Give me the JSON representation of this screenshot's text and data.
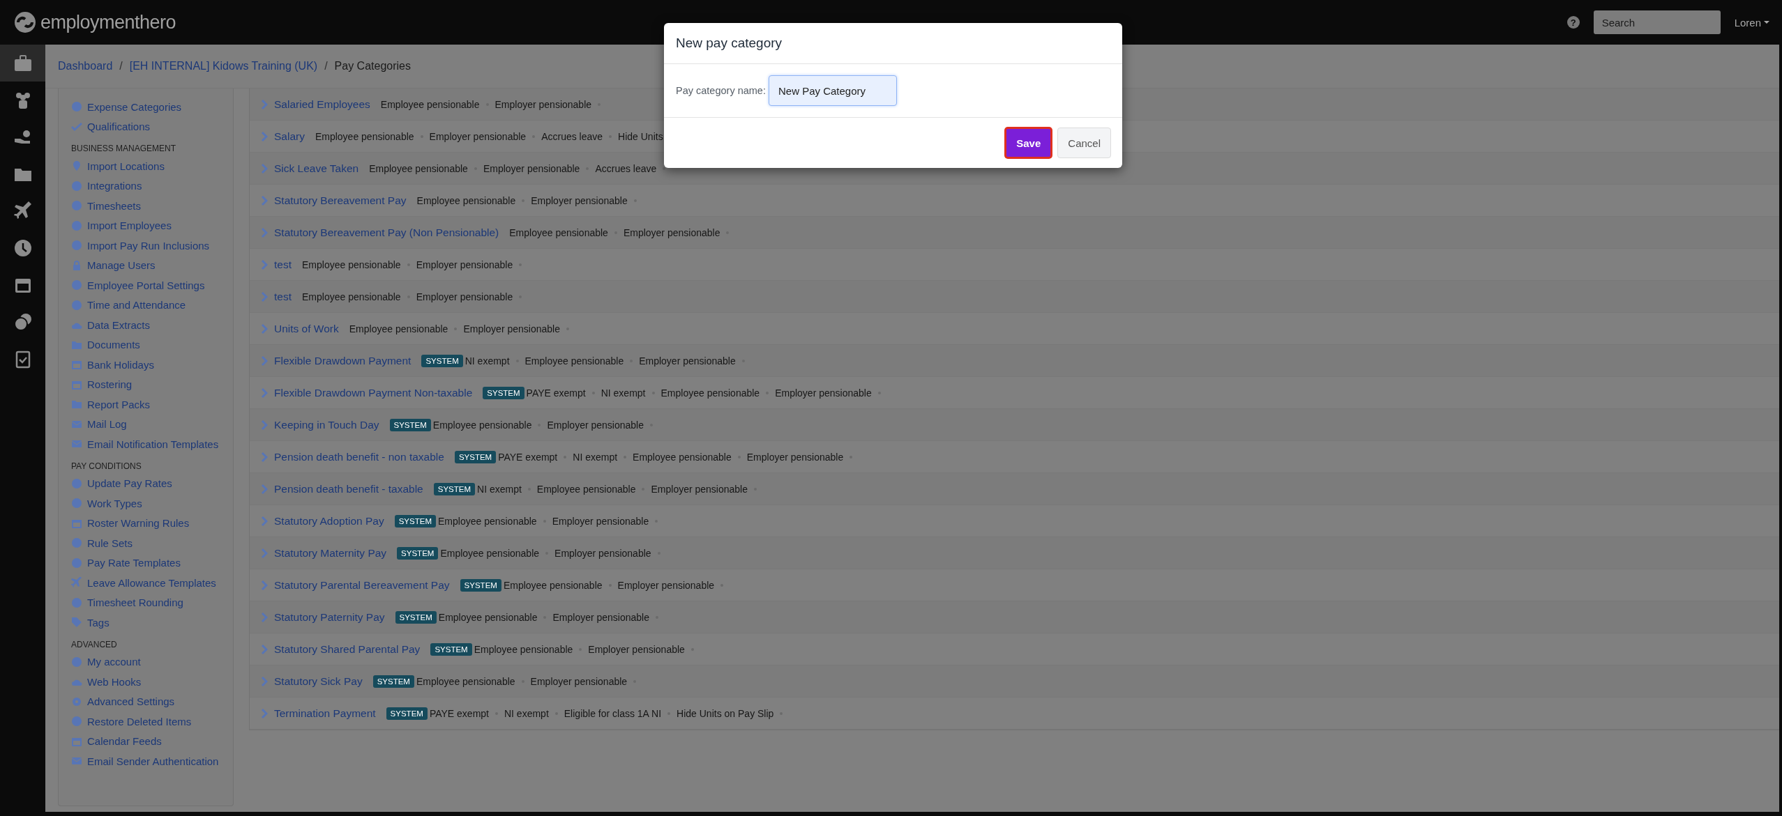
{
  "topbar": {
    "logo": "employmenthero",
    "help": "?",
    "search": {
      "placeholder": "Search"
    },
    "user": "Loren"
  },
  "rail": [
    {
      "selected": true
    },
    {
      "selected": false
    },
    {
      "selected": false
    },
    {
      "selected": false
    },
    {
      "selected": false
    },
    {
      "selected": false
    },
    {
      "selected": false
    },
    {
      "selected": false
    },
    {
      "selected": false
    }
  ],
  "breadcrumb": [
    {
      "label": "Dashboard",
      "link": true
    },
    {
      "separator": "/",
      "label": "[EH INTERNAL] Kidows Training (UK)",
      "link": true
    },
    {
      "separator": "/",
      "label": "Pay Categories",
      "link": false
    }
  ],
  "sidebar": [
    {
      "items": [
        "Expense Categories",
        "Qualifications"
      ]
    },
    {
      "heading": "BUSINESS MANAGEMENT",
      "items": [
        "Import Locations",
        "Integrations",
        "Timesheets",
        "Import Employees",
        "Import Pay Run Inclusions",
        "Manage Users",
        "Employee Portal Settings",
        "Time and Attendance",
        "Data Extracts",
        "Documents",
        "Bank Holidays",
        "Rostering",
        "Report Packs",
        "Mail Log",
        "Email Notification Templates"
      ]
    },
    {
      "heading": "PAY CONDITIONS",
      "items": [
        "Update Pay Rates",
        "Work Types",
        "Roster Warning Rules",
        "Rule Sets",
        "Pay Rate Templates",
        "Leave Allowance Templates",
        "Timesheet Rounding",
        "Tags"
      ]
    },
    {
      "heading": "ADVANCED",
      "items": [
        "My account",
        "Web Hooks",
        "Advanced Settings",
        "Restore Deleted Items",
        "Calendar Feeds",
        "Email Sender Authentication"
      ]
    }
  ],
  "rows": [
    {
      "name": "Salaried Employees",
      "badge": null,
      "tags": [
        "Employee pensionable",
        "Employer pensionable"
      ]
    },
    {
      "name": "Salary",
      "badge": null,
      "tags": [
        "Employee pensionable",
        "Employer pensionable",
        "Accrues leave",
        "Hide Units"
      ]
    },
    {
      "name": "Sick Leave Taken",
      "badge": null,
      "tags": [
        "Employee pensionable",
        "Employer pensionable",
        "Accrues leave"
      ]
    },
    {
      "name": "Statutory Bereavement Pay",
      "badge": null,
      "tags": [
        "Employee pensionable",
        "Employer pensionable"
      ]
    },
    {
      "name": "Statutory Bereavement Pay (Non Pensionable)",
      "badge": null,
      "tags": [
        "Employee pensionable",
        "Employer pensionable"
      ]
    },
    {
      "name": "test",
      "badge": null,
      "tags": [
        "Employee pensionable",
        "Employer pensionable"
      ]
    },
    {
      "name": "test",
      "badge": null,
      "tags": [
        "Employee pensionable",
        "Employer pensionable"
      ]
    },
    {
      "name": "Units of Work",
      "badge": null,
      "tags": [
        "Employee pensionable",
        "Employer pensionable"
      ]
    },
    {
      "name": "Flexible Drawdown Payment",
      "badge": "SYSTEM",
      "tags": [
        "NI exempt",
        "Employee pensionable",
        "Employer pensionable"
      ]
    },
    {
      "name": "Flexible Drawdown Payment Non-taxable",
      "badge": "SYSTEM",
      "tags": [
        "PAYE exempt",
        "NI exempt",
        "Employee pensionable",
        "Employer pensionable"
      ]
    },
    {
      "name": "Keeping in Touch Day",
      "badge": "SYSTEM",
      "tags": [
        "Employee pensionable",
        "Employer pensionable"
      ]
    },
    {
      "name": "Pension death benefit - non taxable",
      "badge": "SYSTEM",
      "tags": [
        "PAYE exempt",
        "NI exempt",
        "Employee pensionable",
        "Employer pensionable"
      ]
    },
    {
      "name": "Pension death benefit - taxable",
      "badge": "SYSTEM",
      "tags": [
        "NI exempt",
        "Employee pensionable",
        "Employer pensionable"
      ]
    },
    {
      "name": "Statutory Adoption Pay",
      "badge": "SYSTEM",
      "tags": [
        "Employee pensionable",
        "Employer pensionable"
      ]
    },
    {
      "name": "Statutory Maternity Pay",
      "badge": "SYSTEM",
      "tags": [
        "Employee pensionable",
        "Employer pensionable"
      ]
    },
    {
      "name": "Statutory Parental Bereavement Pay",
      "badge": "SYSTEM",
      "tags": [
        "Employee pensionable",
        "Employer pensionable"
      ]
    },
    {
      "name": "Statutory Paternity Pay",
      "badge": "SYSTEM",
      "tags": [
        "Employee pensionable",
        "Employer pensionable"
      ]
    },
    {
      "name": "Statutory Shared Parental Pay",
      "badge": "SYSTEM",
      "tags": [
        "Employee pensionable",
        "Employer pensionable"
      ]
    },
    {
      "name": "Statutory Sick Pay",
      "badge": "SYSTEM",
      "tags": [
        "Employee pensionable",
        "Employer pensionable"
      ]
    },
    {
      "name": "Termination Payment",
      "badge": "SYSTEM",
      "tags": [
        "PAYE exempt",
        "NI exempt",
        "Eligible for class 1A NI",
        "Hide Units on Pay Slip"
      ]
    }
  ],
  "modal": {
    "title": "New pay category",
    "label": "Pay category name:",
    "value": "New Pay Category",
    "buttons": [
      {
        "label": "Save",
        "kind": "primary",
        "focused": true
      },
      {
        "label": "Cancel",
        "kind": "default",
        "focused": false
      }
    ]
  }
}
